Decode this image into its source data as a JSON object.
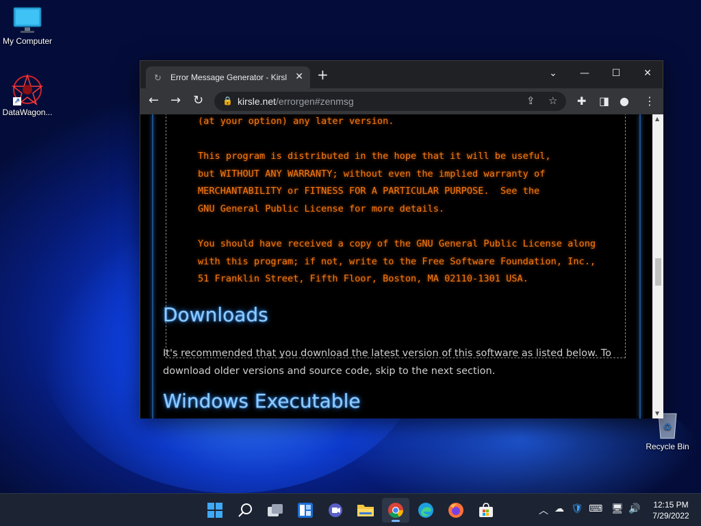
{
  "desktop": {
    "icons": [
      {
        "label": "My Computer"
      },
      {
        "label": "DataWagon..."
      },
      {
        "label": "Recycle Bin"
      }
    ]
  },
  "browser": {
    "tab_title": "Error Message Generator - Kirsle",
    "new_tab": "+",
    "url_host": "kirsle.net",
    "url_path": "/errorgen#zenmsg"
  },
  "page": {
    "license_text": "(at your option) any later version.\n\nThis program is distributed in the hope that it will be useful,\nbut WITHOUT ANY WARRANTY; without even the implied warranty of\nMERCHANTABILITY or FITNESS FOR A PARTICULAR PURPOSE.  See the\nGNU General Public License for more details.\n\nYou should have received a copy of the GNU General Public License along\nwith this program; if not, write to the Free Software Foundation, Inc.,\n51 Franklin Street, Fifth Floor, Boston, MA 02110-1301 USA.",
    "downloads_heading": "Downloads",
    "downloads_text": "It's recommended that you download the latest version of this software as listed below. To download older versions and source code, skip to the next section.",
    "windows_heading": "Windows Executable"
  },
  "taskbar": {
    "time": "12:15 PM",
    "date": "7/29/2022"
  },
  "colors": {
    "license_orange": "#f77b14",
    "heading_blue": "#8ecbff"
  }
}
